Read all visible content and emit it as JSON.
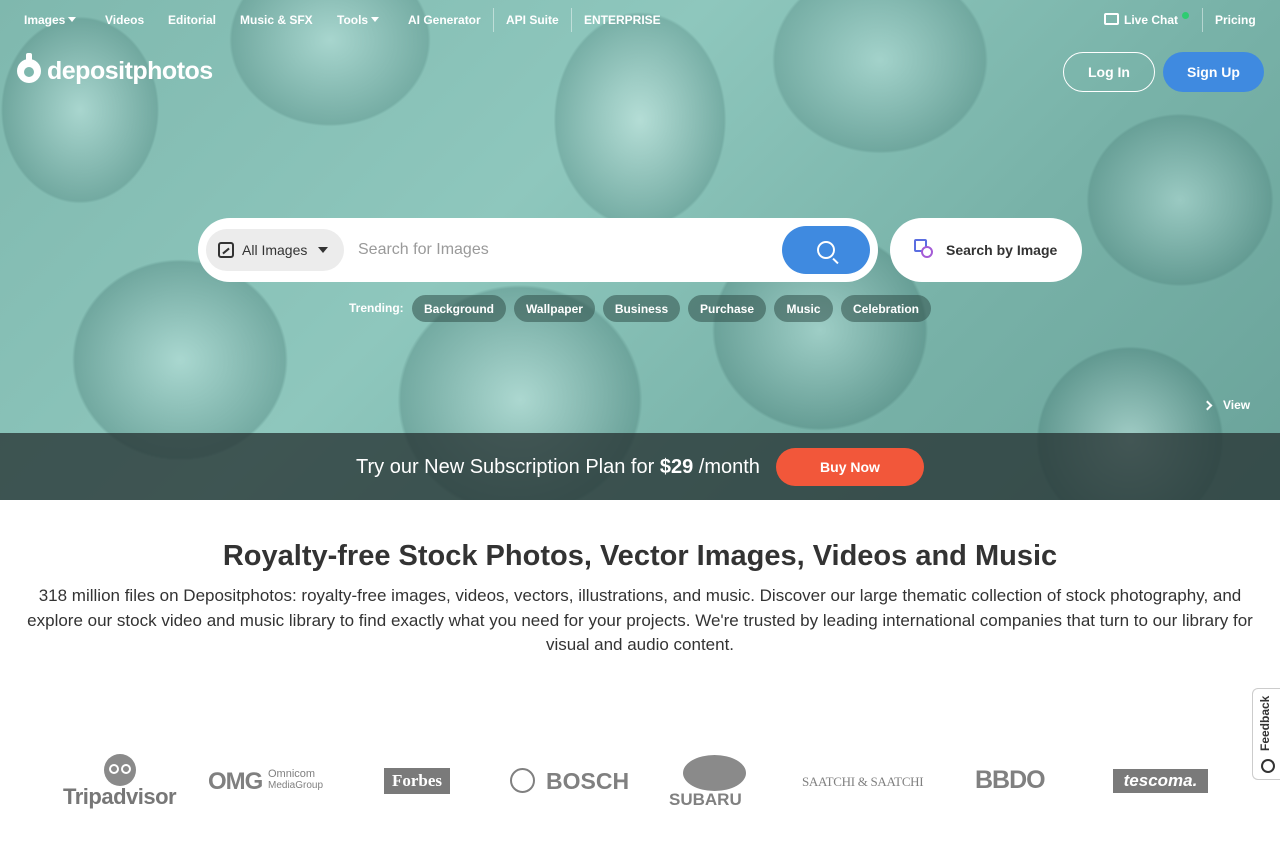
{
  "nav": {
    "images": "Images",
    "videos": "Videos",
    "editorial": "Editorial",
    "music": "Music & SFX",
    "tools": "Tools",
    "ai": "AI Generator",
    "api": "API Suite",
    "enterprise": "ENTERPRISE",
    "live_chat": "Live Chat",
    "pricing": "Pricing"
  },
  "logo": {
    "text": "depositphotos"
  },
  "auth": {
    "login": "Log In",
    "signup": "Sign Up"
  },
  "search": {
    "category": "All Images",
    "placeholder": "Search for Images",
    "by_image": "Search by Image"
  },
  "trending": {
    "label": "Trending:",
    "tags": [
      "Background",
      "Wallpaper",
      "Business",
      "Purchase",
      "Music",
      "Celebration"
    ]
  },
  "hero": {
    "view": "View"
  },
  "promo": {
    "text_before": "Try our New Subscription Plan for ",
    "price": "$29",
    "text_after": " /month",
    "button": "Buy Now"
  },
  "main": {
    "heading": "Royalty-free Stock Photos, Vector Images, Videos and Music",
    "description": "318 million files on Depositphotos: royalty-free images, videos, vectors, illustrations, and music. Discover our large thematic collection of stock photography, and explore our stock video and music library to find exactly what you need for your projects. We're trusted by leading international companies that turn to our library for visual and audio content."
  },
  "brands": {
    "tripadvisor": "Tripadvisor",
    "omg": "OMG",
    "omnicom1": "Omnicom",
    "omnicom2": "MediaGroup",
    "forbes": "Forbes",
    "bosch": "BOSCH",
    "subaru": "SUBARU",
    "saatchi": "SAATCHI & SAATCHI",
    "bbdo": "BBDO",
    "tescoma": "tescoma."
  },
  "feedback": {
    "label": "Feedback"
  },
  "colors": {
    "accent": "#3f8ae0",
    "promo_button": "#f2573a",
    "live_dot": "#2ecc71"
  }
}
